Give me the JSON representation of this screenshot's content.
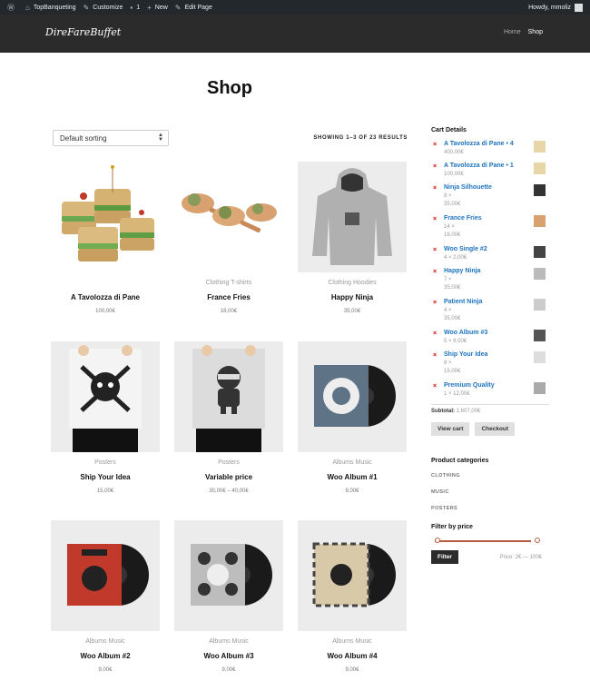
{
  "admin_bar": {
    "items": [
      {
        "icon": "wordpress-icon",
        "label": ""
      },
      {
        "icon": "home-icon",
        "label": "TopBanqueting"
      },
      {
        "icon": "brush-icon",
        "label": "Customize"
      },
      {
        "icon": "comment-icon",
        "label": "1"
      },
      {
        "icon": "plus-icon",
        "label": "New"
      },
      {
        "icon": "pencil-icon",
        "label": "Edit Page"
      }
    ],
    "howdy": "Howdy, mmoliz"
  },
  "header": {
    "logo": "DireFareBuffet",
    "nav": [
      "Home",
      "Shop"
    ]
  },
  "page_title": "Shop",
  "sorting": {
    "selected": "Default sorting"
  },
  "showing": "SHOWING 1–3 OF 23 RESULTS",
  "products": [
    {
      "category": "",
      "name": "A Tavolozza di Pane",
      "price": "100,00€"
    },
    {
      "category": "Clothing T-shirts",
      "name": "France Fries",
      "price": "18,00€"
    },
    {
      "category": "Clothing Hoodies",
      "name": "Happy Ninja",
      "price": "35,00€"
    },
    {
      "category": "Posters",
      "name": "Ship Your Idea",
      "price": "15,00€"
    },
    {
      "category": "Posters",
      "name": "Variable price",
      "price": "30,00€ – 40,00€"
    },
    {
      "category": "Albums Music",
      "name": "Woo Album #1",
      "price": "9,00€"
    },
    {
      "category": "Albums Music",
      "name": "Woo Album #2",
      "price": "9,00€"
    },
    {
      "category": "Albums Music",
      "name": "Woo Album #3",
      "price": "9,00€"
    },
    {
      "category": "Albums Music",
      "name": "Woo Album #4",
      "price": "9,00€"
    }
  ],
  "sidebar": {
    "cart_title": "Cart Details",
    "cart_items": [
      {
        "name": "A Tavolozza di Pane • 4",
        "qty": "400,00€"
      },
      {
        "name": "A Tavolozza di Pane • 1",
        "qty": "100,00€"
      },
      {
        "name": "Ninja Silhouette",
        "qty": "8 ×"
      },
      {
        "name": "",
        "qty": "35,00€"
      },
      {
        "name": "France Fries",
        "qty": "14 ×"
      },
      {
        "name": "",
        "qty": "18,00€"
      },
      {
        "name": "Woo Single #2",
        "qty": "4 × 2,00€"
      },
      {
        "name": "Happy Ninja",
        "qty": "7 ×"
      },
      {
        "name": "",
        "qty": "35,00€"
      },
      {
        "name": "Patient Ninja",
        "qty": "4 ×"
      },
      {
        "name": "",
        "qty": "35,00€"
      },
      {
        "name": "Woo Album #3",
        "qty": "5 × 9,00€"
      },
      {
        "name": "Ship Your Idea",
        "qty": "8 ×"
      },
      {
        "name": "",
        "qty": "15,00€"
      },
      {
        "name": "Premium Quality",
        "qty": "1 × 12,00€"
      }
    ],
    "subtotal_label": "Subtotal:",
    "subtotal_value": "1.607,00€",
    "view_cart": "View cart",
    "checkout": "Checkout",
    "categories_title": "Product categories",
    "categories": [
      "CLOTHING",
      "MUSIC",
      "POSTERS"
    ],
    "filter_title": "Filter by price",
    "filter_button": "Filter",
    "price_range": "Price: 2€ — 100€"
  }
}
